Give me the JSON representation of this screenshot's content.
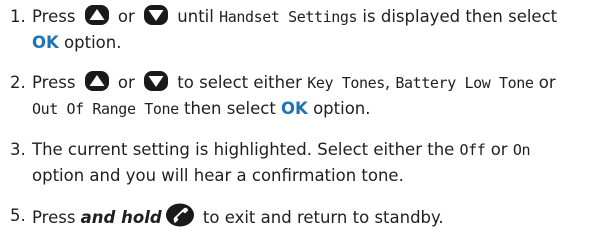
{
  "steps": [
    {
      "num": "1.",
      "t1": "Press ",
      "t2": " or ",
      "t3": " until ",
      "m1": "Handset Settings",
      "t4": " is displayed then select ",
      "ok": "OK",
      "t5": " option.",
      "icons": [
        "up-arrow-icon",
        "down-arrow-icon"
      ]
    },
    {
      "num": "2.",
      "t1": "Press ",
      "t2": " or ",
      "t3": " to select either ",
      "m1": "Key Tones",
      "t4": ", ",
      "m2": "Battery Low Tone",
      "t5": " or ",
      "m3": "Out Of Range Tone",
      "t6": " then select ",
      "ok": "OK",
      "t7": " option.",
      "icons": [
        "up-arrow-icon",
        "down-arrow-icon"
      ]
    },
    {
      "num": "3.",
      "t1": "The current setting is highlighted. Select either the ",
      "m1": "Off",
      "t2": " or ",
      "m2": "On",
      "t3": " option and you will hear a confirmation tone."
    },
    {
      "num": "5.",
      "t1": "Press ",
      "b1": "and hold",
      "t2": " to exit and return to standby.",
      "icons": [
        "end-call-icon"
      ]
    }
  ],
  "colors": {
    "text": "#1f1f1f",
    "ok": "#1f73b7",
    "icon": "#1a1a1a"
  }
}
